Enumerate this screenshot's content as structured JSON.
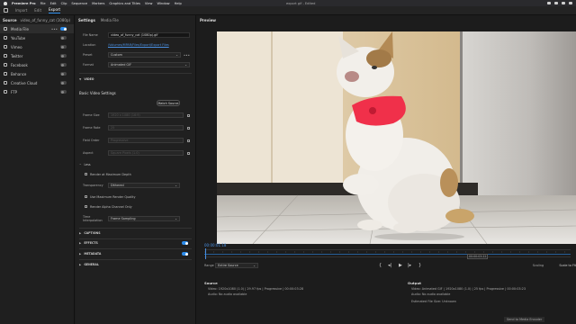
{
  "menubar": {
    "app": "Premiere Pro",
    "items": [
      "File",
      "Edit",
      "Clip",
      "Sequence",
      "Markers",
      "Graphics and Titles",
      "View",
      "Window",
      "Help"
    ],
    "window_title": "export gif - Edited"
  },
  "workspace": {
    "tabs": [
      "Import",
      "Edit",
      "Export"
    ],
    "active": "Export"
  },
  "source_panel": {
    "label": "Source",
    "file": "video_of_funny_cat (1080p)",
    "destinations": [
      {
        "label": "Media File",
        "enabled": true,
        "selected": true
      },
      {
        "label": "YouTube",
        "enabled": false
      },
      {
        "label": "Vimeo",
        "enabled": false
      },
      {
        "label": "Twitter",
        "enabled": false
      },
      {
        "label": "Facebook",
        "enabled": false
      },
      {
        "label": "Behance",
        "enabled": false
      },
      {
        "label": "Creative Cloud",
        "enabled": false
      },
      {
        "label": "FTP",
        "enabled": false
      }
    ]
  },
  "settings": {
    "title": "Settings",
    "subtitle": "Media File",
    "file_name_label": "File Name",
    "file_name": "video_of_funny_cat (1080p).gif",
    "location_label": "Location",
    "location": "/Volumes/MPAR/Files/Export/Export Files",
    "preset_label": "Preset",
    "preset": "Custom",
    "format_label": "Format",
    "format": "Animated GIF",
    "video_section": "VIDEO",
    "basic_title": "Basic Video Settings",
    "match_source": "Match Source",
    "frame_size_label": "Frame Size",
    "frame_size": "1920 x 1080 (16:9)",
    "frame_rate_label": "Frame Rate",
    "frame_rate": "25",
    "field_order_label": "Field Order",
    "field_order": "Progressive",
    "aspect_label": "Aspect",
    "aspect": "Square Pixels (1.0)",
    "more_label": "Less",
    "render_max_depth": "Render at Maximum Depth",
    "transparency_label": "Transparency",
    "transparency": "Dithered",
    "use_max_quality": "Use Maximum Render Quality",
    "render_alpha": "Render Alpha Channel Only",
    "time_interp_label": "Time Interpolation",
    "time_interp": "Frame Sampling",
    "sections": [
      "CAPTIONS",
      "EFFECTS",
      "METADATA",
      "GENERAL"
    ]
  },
  "preview": {
    "title": "Preview",
    "timecode": "00:00:01:18",
    "timecode_end": "00:00:03:22",
    "range_label": "Range",
    "range": "Entire Source",
    "scaling_label": "Scaling",
    "scaling": "Scale to Fit"
  },
  "source_info": {
    "title": "Source",
    "video": "Video:   1920x1080 (1.0)  |  29.97 fps  |  Progressive  |  00:00:03:28",
    "audio": "Audio:   No audio available"
  },
  "output_info": {
    "title": "Output",
    "video": "Video:   Animated GIF  |  1920x1080 (1.0)  |  25 fps  |  Progressive  |  00:00:03:23",
    "audio": "Audio:   No audio available",
    "size": "Estimated File Size:   Unknown"
  },
  "dock": {
    "label": "Send to Media Encoder"
  }
}
